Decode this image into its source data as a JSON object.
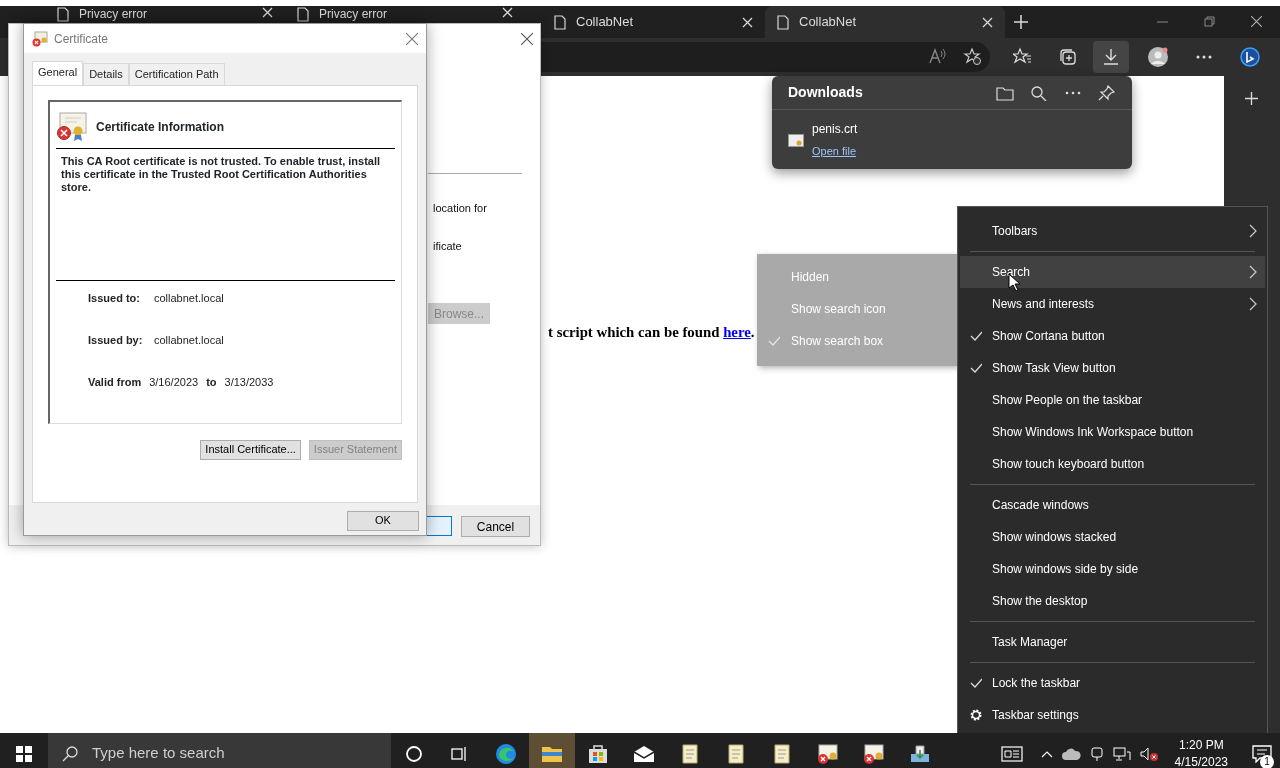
{
  "browser": {
    "tabs": [
      {
        "title": "Privacy error",
        "selected": false
      },
      {
        "title": "Privacy error",
        "selected": false
      },
      {
        "title": "CollabNet",
        "selected": false
      },
      {
        "title": "CollabNet",
        "selected": true
      }
    ],
    "toolbar": {
      "downloads_active": true
    }
  },
  "downloads_panel": {
    "title": "Downloads",
    "items": [
      {
        "file": "penis.crt",
        "action": "Open file"
      }
    ]
  },
  "page": {
    "text": "t script which can be found ",
    "link": "here",
    "end": "."
  },
  "import_wizard": {
    "texts": [
      "location for",
      "ificate"
    ],
    "browse_button": {
      "label": "Browse...",
      "disabled": true
    },
    "cancel_button": "Cancel"
  },
  "certificate_dialog": {
    "title": "Certificate",
    "tabs": [
      {
        "label": "General",
        "selected": true
      },
      {
        "label": "Details",
        "selected": false
      },
      {
        "label": "Certification Path",
        "selected": false
      }
    ],
    "heading": "Certificate Information",
    "message": "This CA Root certificate is not trusted. To enable trust, install this certificate in the Trusted Root Certification Authorities store.",
    "fields": [
      {
        "label": "Issued to:",
        "value": "collabnet.local"
      },
      {
        "label": "Issued by:",
        "value": "collabnet.local"
      }
    ],
    "validity": {
      "label": "Valid from",
      "from": "3/16/2023",
      "separator": "to",
      "to": "3/13/2033"
    },
    "buttons": [
      {
        "label": "Install Certificate...",
        "disabled": false
      },
      {
        "label": "Issuer Statement",
        "disabled": true
      }
    ],
    "ok_button": "OK"
  },
  "search_submenu": {
    "disabled": true,
    "items": [
      {
        "label": "Hidden",
        "checked": false
      },
      {
        "label": "Show search icon",
        "checked": false
      },
      {
        "label": "Show search box",
        "checked": true
      }
    ]
  },
  "context_menu": {
    "groups": [
      [
        {
          "label": "Toolbars",
          "kind": "submenu",
          "checked": false,
          "selected": false
        }
      ],
      [
        {
          "label": "Search",
          "kind": "submenu",
          "checked": false,
          "selected": true
        },
        {
          "label": "News and interests",
          "kind": "submenu",
          "checked": false,
          "selected": false
        },
        {
          "label": "Show Cortana button",
          "kind": "toggle",
          "checked": true,
          "selected": false
        },
        {
          "label": "Show Task View button",
          "kind": "toggle",
          "checked": true,
          "selected": false
        },
        {
          "label": "Show People on the taskbar",
          "kind": "toggle",
          "checked": false,
          "selected": false
        },
        {
          "label": "Show Windows Ink Workspace button",
          "kind": "toggle",
          "checked": false,
          "selected": false
        },
        {
          "label": "Show touch keyboard button",
          "kind": "toggle",
          "checked": false,
          "selected": false
        }
      ],
      [
        {
          "label": "Cascade windows",
          "kind": "command",
          "checked": false,
          "selected": false
        },
        {
          "label": "Show windows stacked",
          "kind": "command",
          "checked": false,
          "selected": false
        },
        {
          "label": "Show windows side by side",
          "kind": "command",
          "checked": false,
          "selected": false
        },
        {
          "label": "Show the desktop",
          "kind": "command",
          "checked": false,
          "selected": false
        }
      ],
      [
        {
          "label": "Task Manager",
          "kind": "command",
          "checked": false,
          "selected": false
        }
      ],
      [
        {
          "label": "Lock the taskbar",
          "kind": "toggle",
          "checked": true,
          "selected": false
        },
        {
          "label": "Taskbar settings",
          "kind": "settings",
          "checked": false,
          "selected": false
        }
      ]
    ]
  },
  "taskbar": {
    "search_placeholder": "Type here to search",
    "apps": [
      {
        "kind": "edge",
        "active": false
      },
      {
        "kind": "explorer",
        "active": true
      },
      {
        "kind": "store",
        "active": false
      },
      {
        "kind": "mail",
        "active": false
      },
      {
        "kind": "document",
        "active": false
      },
      {
        "kind": "document",
        "active": false
      },
      {
        "kind": "document",
        "active": false
      },
      {
        "kind": "certificate",
        "active": false
      },
      {
        "kind": "certificate",
        "active": false
      },
      {
        "kind": "installer",
        "active": false
      }
    ],
    "time": "1:20 PM",
    "date": "4/15/2023",
    "notification_count": "1"
  }
}
